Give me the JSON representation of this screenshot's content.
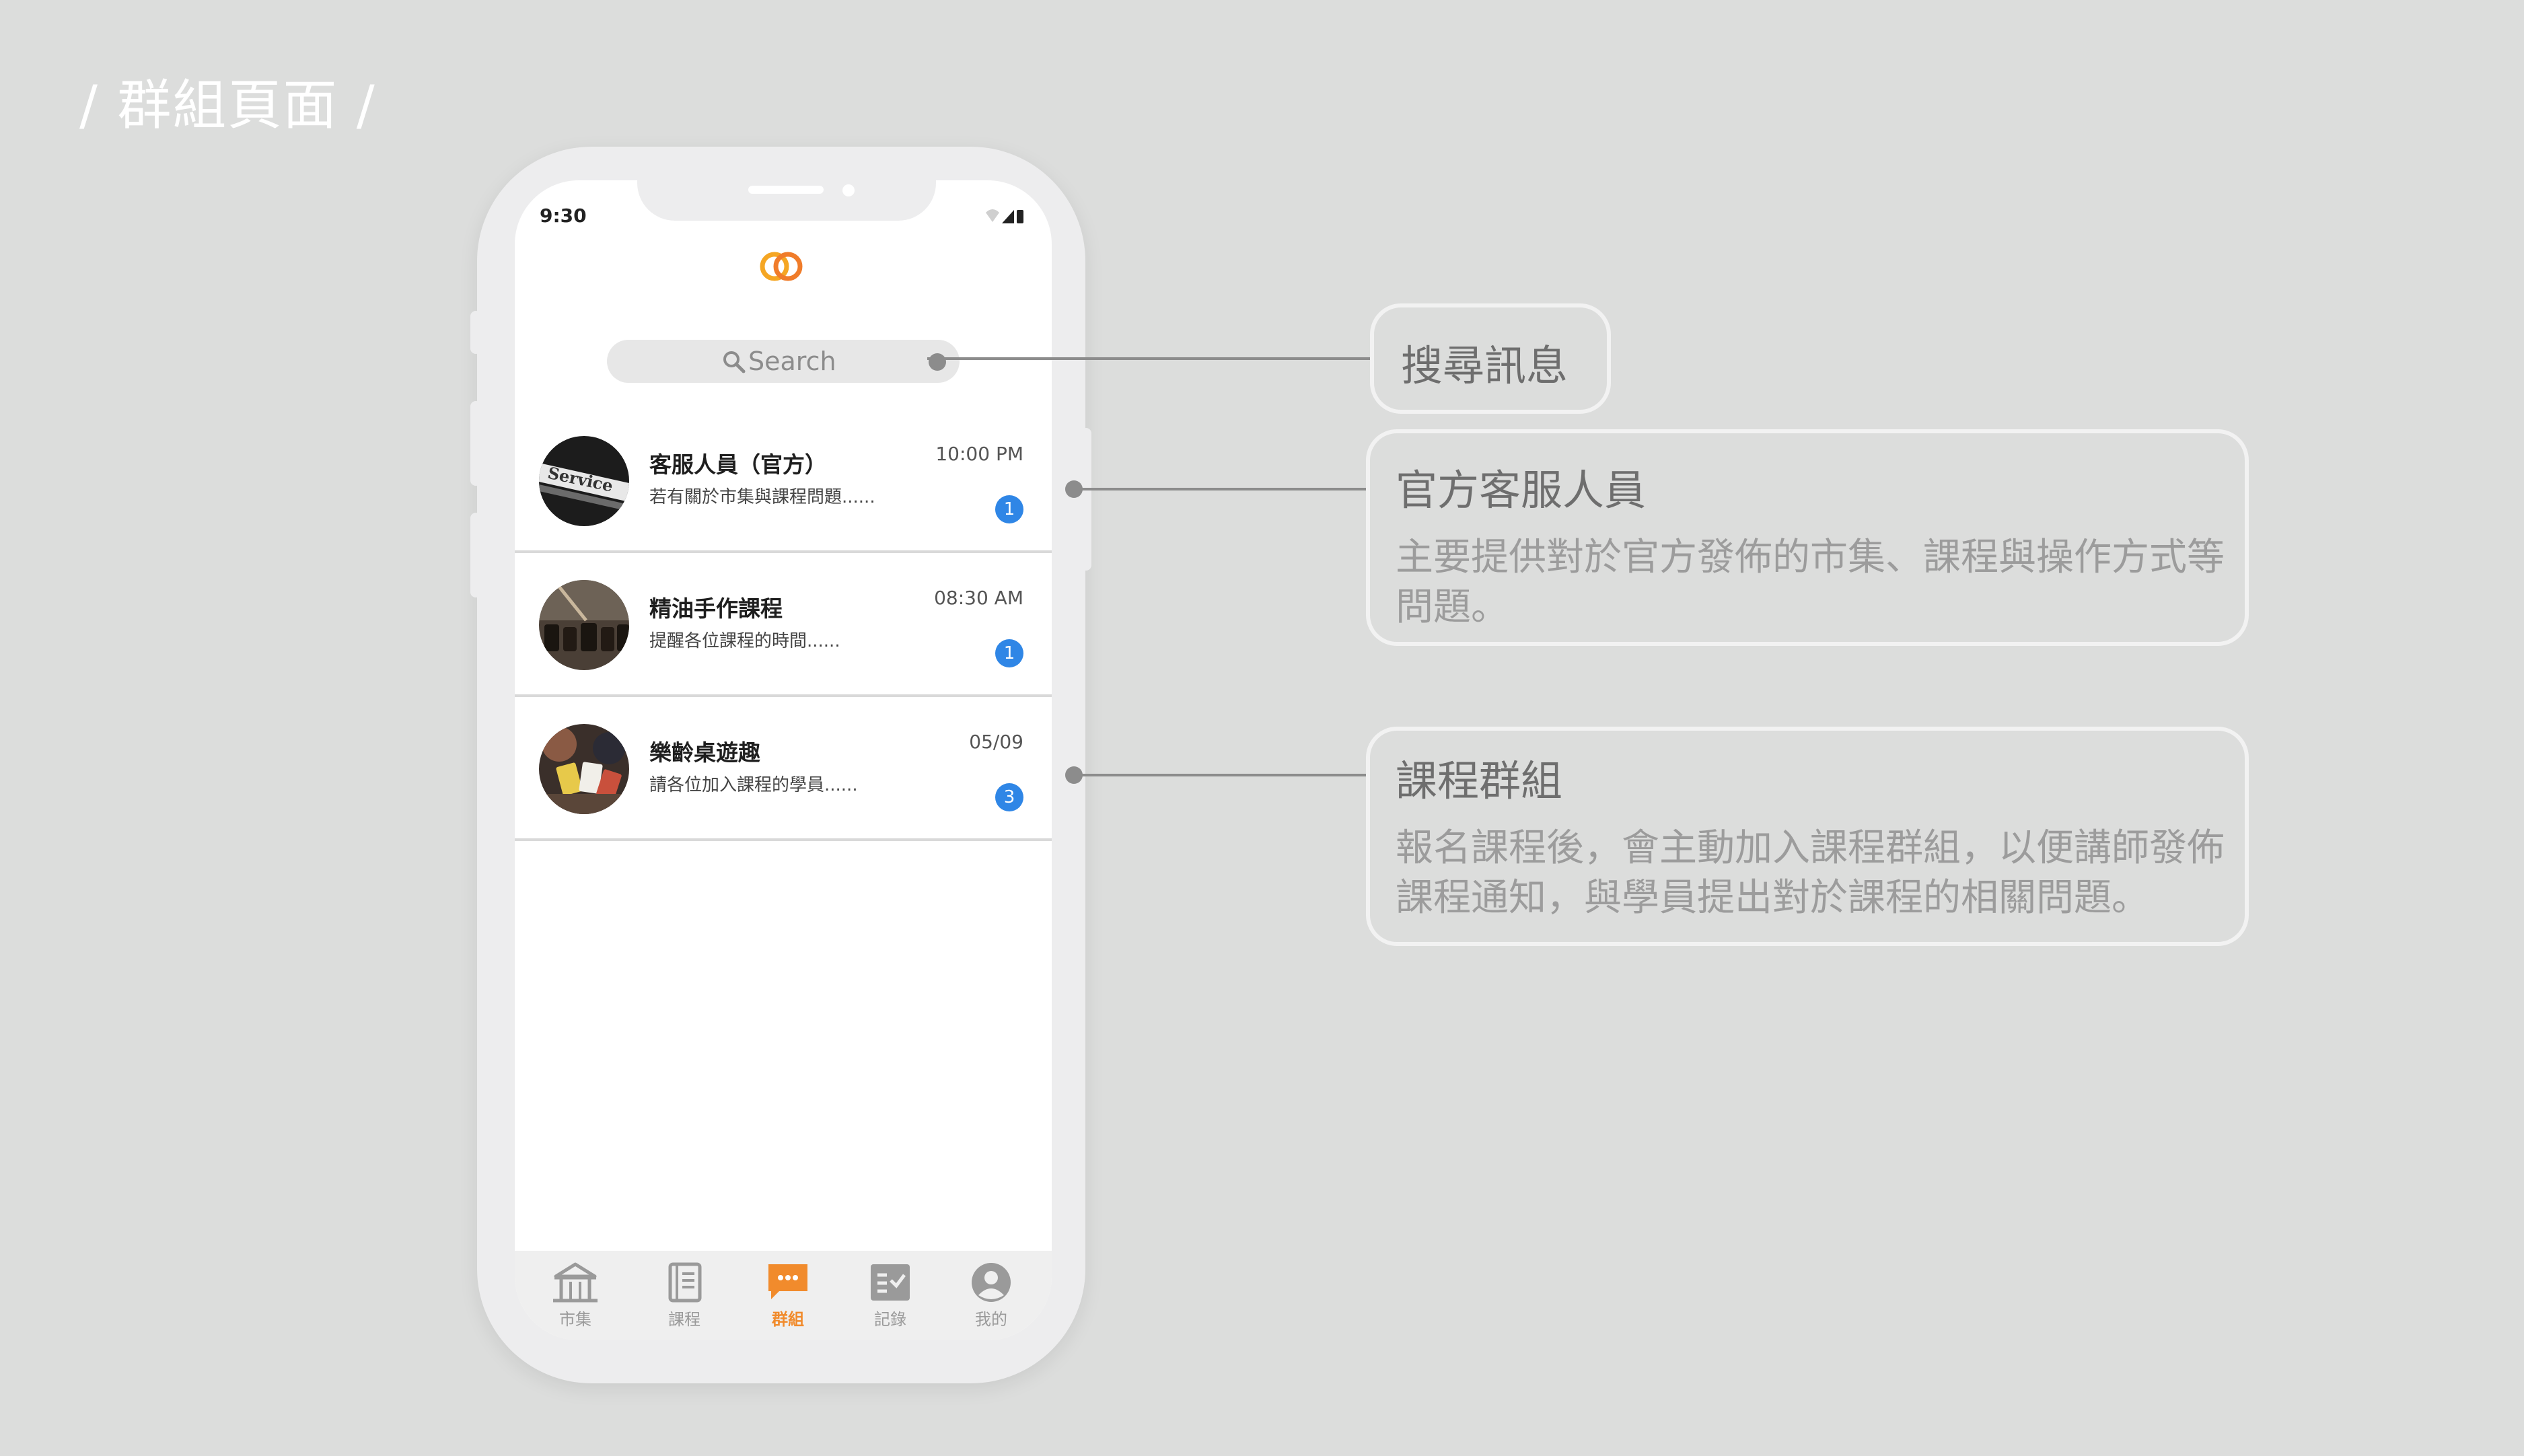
{
  "page": {
    "title": "/ 群組頁面 /"
  },
  "status_bar": {
    "time": "9:30"
  },
  "search": {
    "placeholder": "Search"
  },
  "chats": [
    {
      "name": "客服人員（官方）",
      "preview": "若有關於市集與課程問題......",
      "time": "10:00 PM",
      "unread": "1",
      "avatar": "service-avatar"
    },
    {
      "name": "精油手作課程",
      "preview": "提醒各位課程的時間......",
      "time": "08:30 AM",
      "unread": "1",
      "avatar": "essential-oil-avatar"
    },
    {
      "name": "樂齡桌遊趣",
      "preview": "請各位加入課程的學員......",
      "time": "05/09",
      "unread": "3",
      "avatar": "board-game-avatar"
    }
  ],
  "tabbar": {
    "items": [
      {
        "label": "市集",
        "icon": "market-icon",
        "active": false
      },
      {
        "label": "課程",
        "icon": "course-book-icon",
        "active": false
      },
      {
        "label": "群組",
        "icon": "chat-group-icon",
        "active": true
      },
      {
        "label": "記錄",
        "icon": "record-checklist-icon",
        "active": false
      },
      {
        "label": "我的",
        "icon": "profile-icon",
        "active": false
      }
    ]
  },
  "callouts": {
    "search": {
      "title": "搜尋訊息"
    },
    "official": {
      "title": "官方客服人員",
      "body": "主要提供對於官方發佈的市集、課程與操作方式等問題。"
    },
    "group": {
      "title": "課程群組",
      "body": "報名課程後，會主動加入課程群組，以便講師發佈課程通知，與學員提出對於課程的相關問題。"
    }
  },
  "colors": {
    "accent": "#f18b2c",
    "badge": "#2f86e6",
    "background": "#dcdddc",
    "connector": "#8c8c8c"
  }
}
